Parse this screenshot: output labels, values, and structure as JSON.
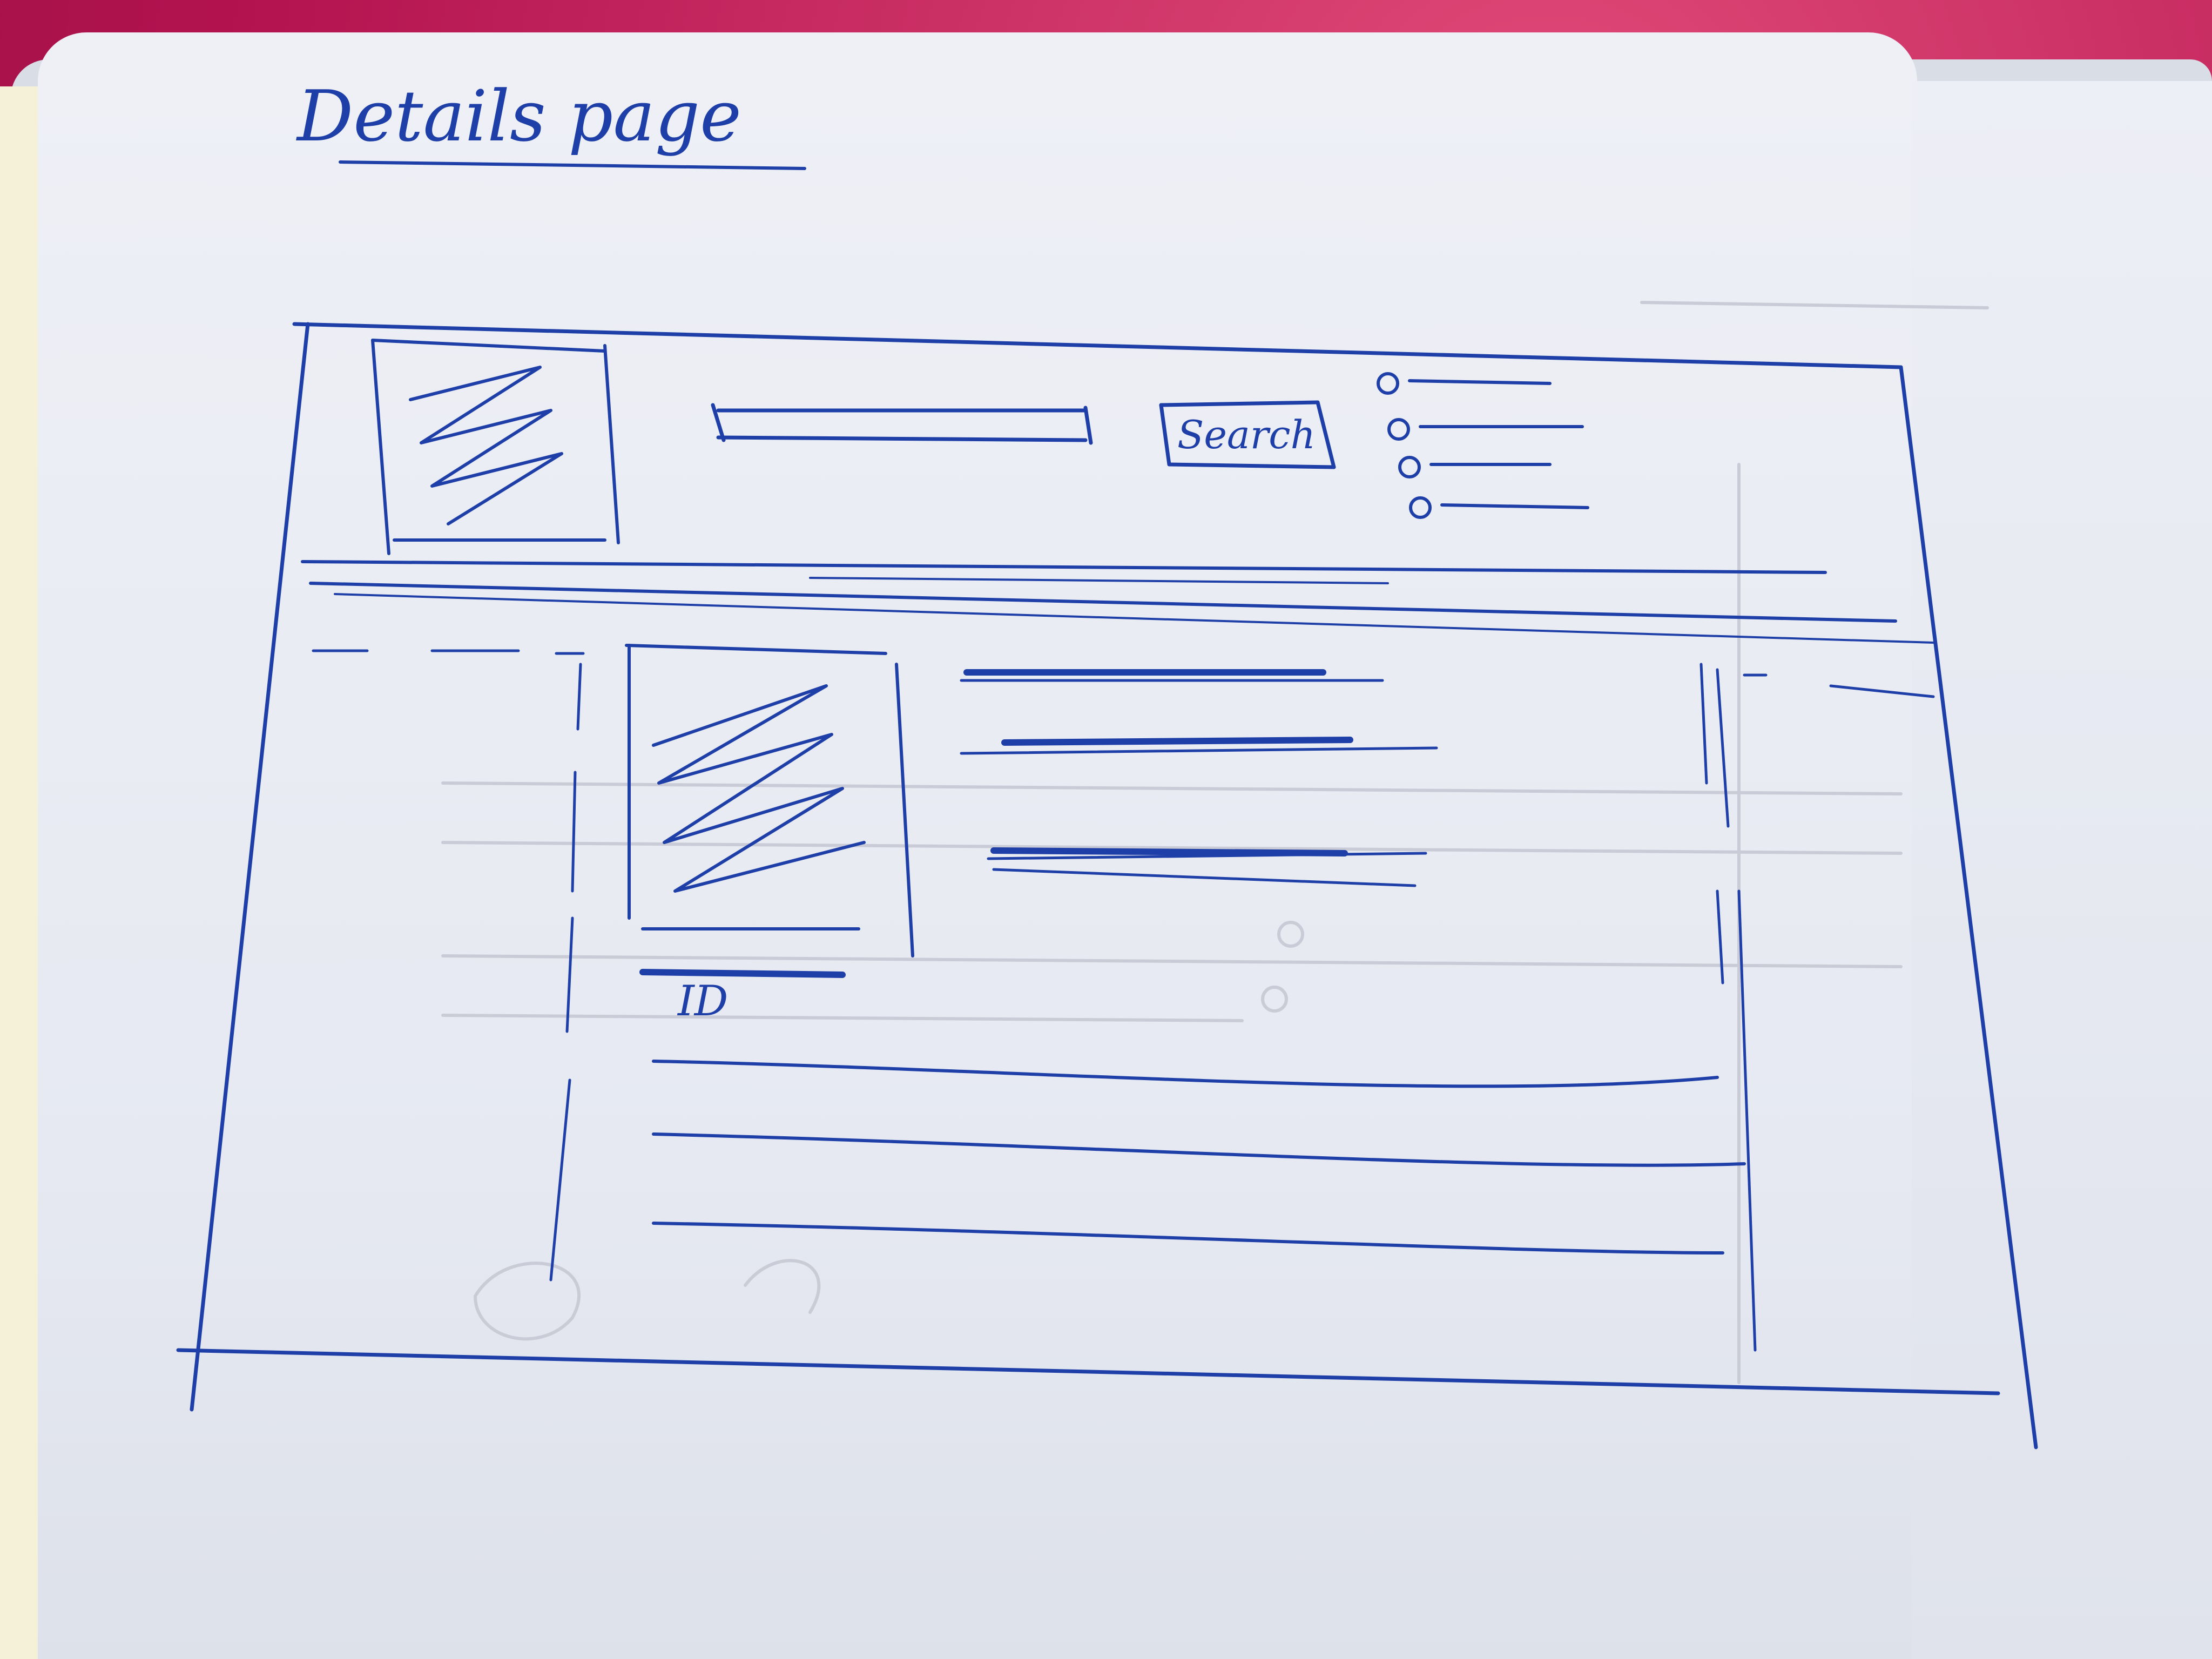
{
  "sketch": {
    "title": "Details page",
    "search_label": "Search",
    "id_label": "ID"
  },
  "colors": {
    "ink": "#1f3fa8",
    "paper": "#eceff5",
    "background": "#c2185b"
  }
}
